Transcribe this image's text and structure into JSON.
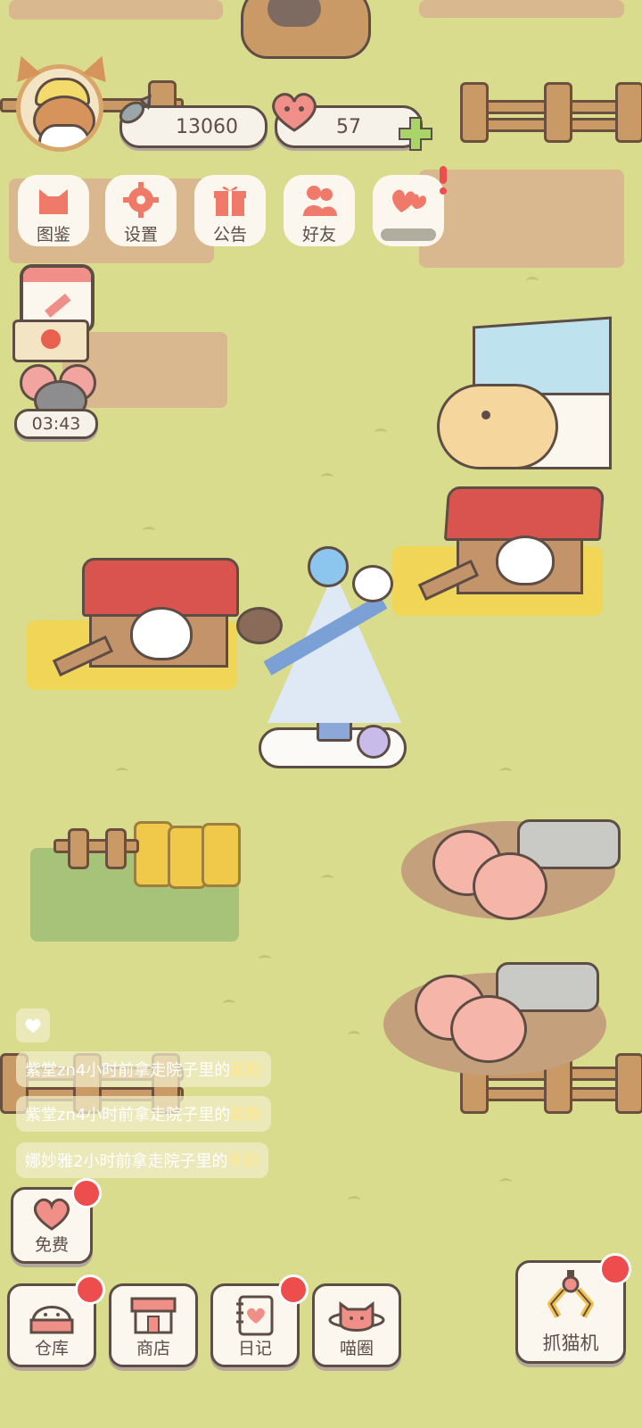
{
  "currency": {
    "fish_icon": "fish-icon",
    "fish_amount": "13060",
    "heart_icon": "heart-icon",
    "heart_amount": "57",
    "add_icon": "plus-icon"
  },
  "top_menu": [
    {
      "label": "图鉴",
      "icon": "cat-head-icon"
    },
    {
      "label": "设置",
      "icon": "gear-icon"
    },
    {
      "label": "公告",
      "icon": "gift-icon"
    },
    {
      "label": "好友",
      "icon": "friends-icon"
    },
    {
      "label": "",
      "icon": "hearts-icon"
    }
  ],
  "timer": "03:43",
  "feed": [
    {
      "name": "紫堂zn",
      "middle": "4小时前拿走院子里的",
      "item": "面粉"
    },
    {
      "name": "紫堂zn",
      "middle": "4小时前拿走院子里的",
      "item": "面粉"
    },
    {
      "name": "娜妙雅",
      "middle": "2小时前拿走院子里的",
      "item": "牛奶"
    }
  ],
  "free_button": {
    "label": "免费",
    "icon": "heart-icon"
  },
  "bottom_nav": [
    {
      "label": "仓库",
      "icon": "storage-icon"
    },
    {
      "label": "商店",
      "icon": "shop-icon"
    },
    {
      "label": "日记",
      "icon": "diary-icon"
    },
    {
      "label": "喵圈",
      "icon": "planet-cat-icon"
    }
  ],
  "claw_machine": {
    "label": "抓猫机",
    "icon": "claw-icon"
  },
  "colors": {
    "background": "#d9dc8c",
    "badge": "#ee4d4d",
    "accent": "#f08f88"
  }
}
